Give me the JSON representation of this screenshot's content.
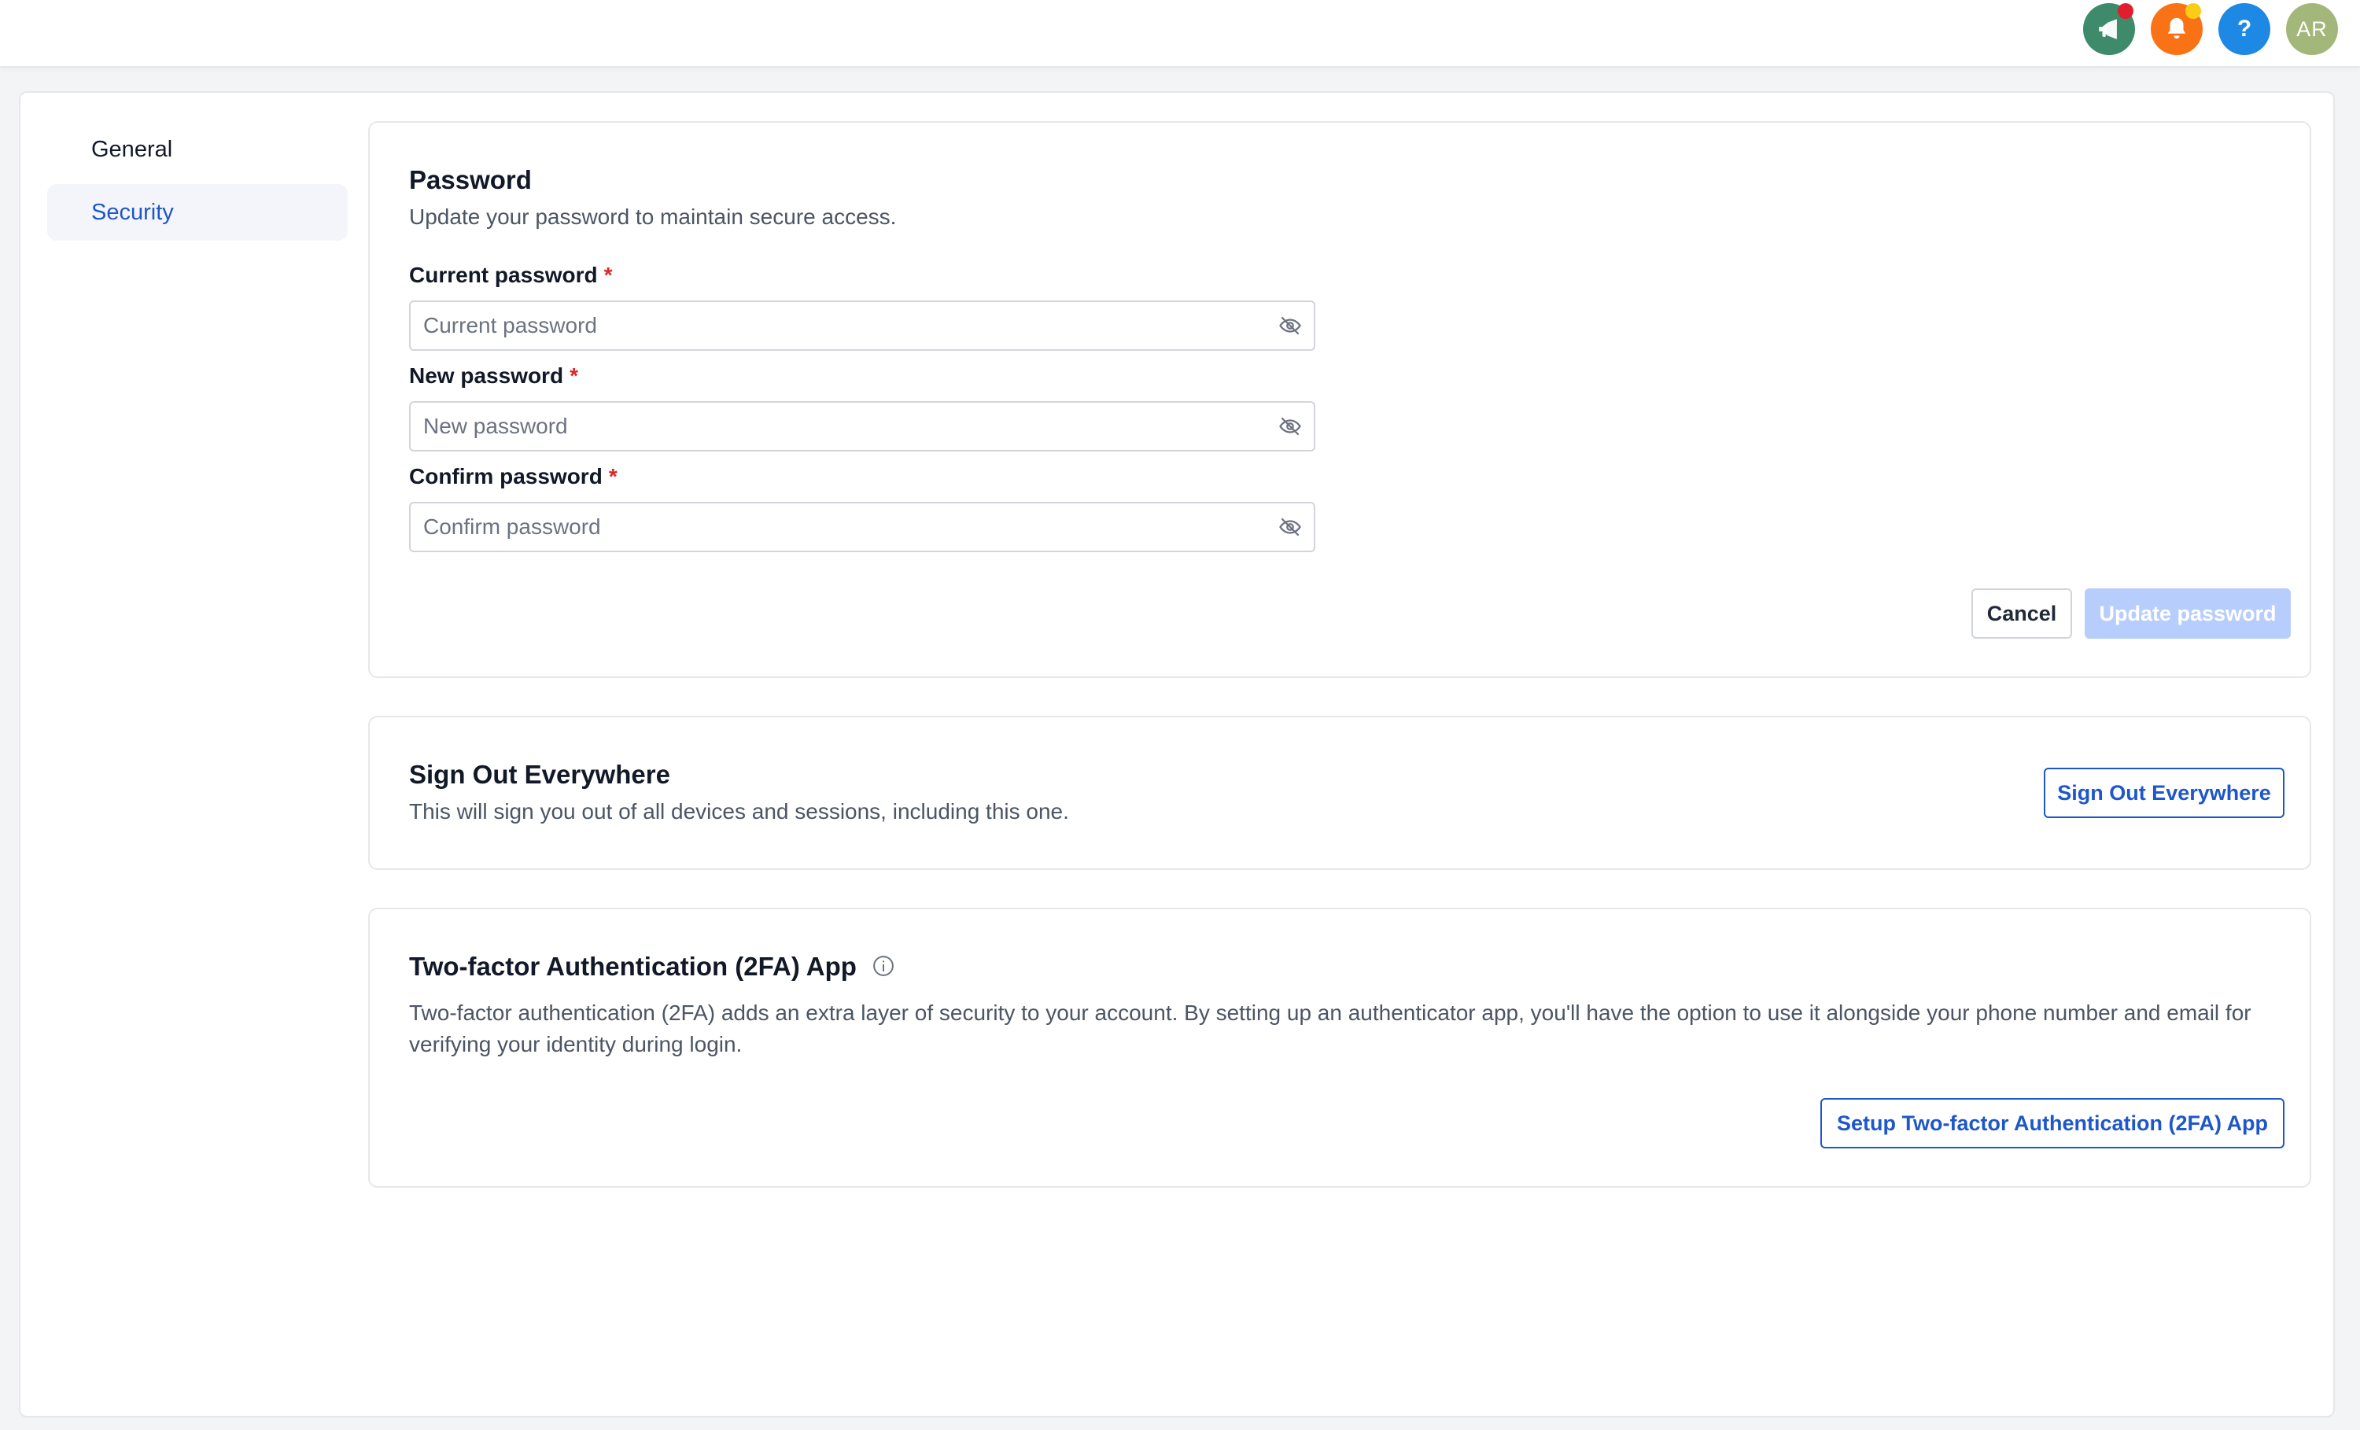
{
  "topbar": {
    "icons": [
      {
        "name": "megaphone-icon",
        "color": "#3d8b6b",
        "badge_color": "#e11d2e"
      },
      {
        "name": "bell-icon",
        "color": "#f97316",
        "badge_color": "#facc15"
      },
      {
        "name": "help-icon",
        "color": "#1e88e5",
        "glyph": "?"
      },
      {
        "name": "avatar",
        "color": "#a3b77a",
        "initials": "AR"
      }
    ]
  },
  "sidebar": {
    "items": [
      {
        "label": "General",
        "active": false
      },
      {
        "label": "Security",
        "active": true
      }
    ]
  },
  "password": {
    "title": "Password",
    "description": "Update your password to maintain secure access.",
    "required_mark": "*",
    "fields": [
      {
        "label": "Current password",
        "placeholder": "Current password",
        "value": ""
      },
      {
        "label": "New password",
        "placeholder": "New password",
        "value": ""
      },
      {
        "label": "Confirm password",
        "placeholder": "Confirm password",
        "value": ""
      }
    ],
    "cancel_label": "Cancel",
    "update_label": "Update password"
  },
  "signout": {
    "title": "Sign Out Everywhere",
    "description": "This will sign you out of all devices and sessions, including this one.",
    "button_label": "Sign Out Everywhere"
  },
  "twofa": {
    "title": "Two-factor Authentication (2FA) App",
    "description": "Two-factor authentication (2FA) adds an extra layer of security to your account. By setting up an authenticator app, you'll have the option to use it alongside your phone number and email for verifying your identity during login.",
    "button_label": "Setup Two-factor Authentication (2FA) App"
  },
  "colors": {
    "accent": "#1e57c9",
    "required": "#dc2626",
    "disabled_primary": "#b7cdfb"
  }
}
